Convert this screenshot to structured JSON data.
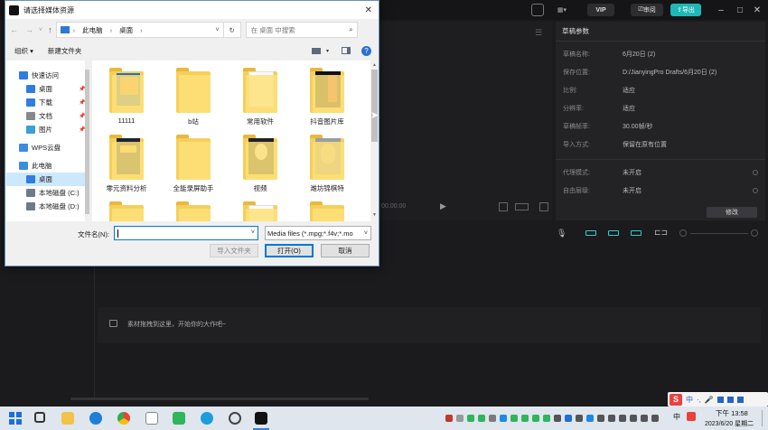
{
  "app": {
    "vip_label": "VIP",
    "review_label": "审阅",
    "export_label": "导出"
  },
  "props": {
    "title": "草稿参数",
    "rows": [
      {
        "k": "草稿名称:",
        "v": "6月20日 (2)"
      },
      {
        "k": "保存位置:",
        "v": "D:/JianyingPro Drafts/6月20日 (2)"
      },
      {
        "k": "比例:",
        "v": "适应"
      },
      {
        "k": "分辨率:",
        "v": "适应"
      },
      {
        "k": "草稿帧率:",
        "v": "30.00帧/秒"
      },
      {
        "k": "导入方式:",
        "v": "保留在原有位置"
      }
    ],
    "rows2": [
      {
        "k": "代理模式:",
        "v": "未开启"
      },
      {
        "k": "自由层级:",
        "v": "未开启"
      }
    ],
    "modify_label": "修改"
  },
  "player": {
    "time": "00:00:00"
  },
  "timeline": {
    "hint": "素材拖拽到这里，开始你的大作吧~"
  },
  "dialog": {
    "title": "请选择媒体资源",
    "breadcrumb": [
      "此电脑",
      "桌面"
    ],
    "search_placeholder": "在 桌面 中搜索",
    "organize_label": "组织 ▾",
    "new_folder_label": "新建文件夹",
    "nav": [
      {
        "label": "快速访问",
        "color": "#2f7de1"
      },
      {
        "label": "桌面",
        "color": "#2f7de1",
        "pinned": true
      },
      {
        "label": "下载",
        "color": "#2f7de1",
        "pinned": true
      },
      {
        "label": "文档",
        "color": "#888",
        "pinned": true
      },
      {
        "label": "图片",
        "color": "#3aa0d8",
        "pinned": true
      },
      {
        "label": "WPS云盘",
        "color": "#3b8de0"
      },
      {
        "label": "此电脑",
        "color": "#3b8de0"
      },
      {
        "label": "桌面",
        "color": "#2f7de1",
        "selected": true
      },
      {
        "label": "本地磁盘 (C:)",
        "color": "#6d7a8a"
      },
      {
        "label": "本地磁盘 (D:)",
        "color": "#6d7a8a"
      }
    ],
    "files": [
      {
        "name": "11111",
        "kind": "folder-img",
        "accent": "#2a6fb8"
      },
      {
        "name": "b站",
        "kind": "folder"
      },
      {
        "name": "常用软件",
        "kind": "folder-doc"
      },
      {
        "name": "抖音图片库",
        "kind": "folder-dark"
      },
      {
        "name": "零元资料分析",
        "kind": "folder-book"
      },
      {
        "name": "全能录屏助手",
        "kind": "folder"
      },
      {
        "name": "视频",
        "kind": "folder-face"
      },
      {
        "name": "潍坊锦棋特",
        "kind": "folder-photo"
      }
    ],
    "filename_label": "文件名(N):",
    "filename_value": "",
    "filter_value": "Media files (*.mpg;*.f4v;*.mo",
    "import_label": "导入文件夹",
    "open_label": "打开(O)",
    "cancel_label": "取消"
  },
  "taskbar": {
    "time": "下午 13:58",
    "date": "2023/6/20 星期二",
    "ime": "中"
  }
}
